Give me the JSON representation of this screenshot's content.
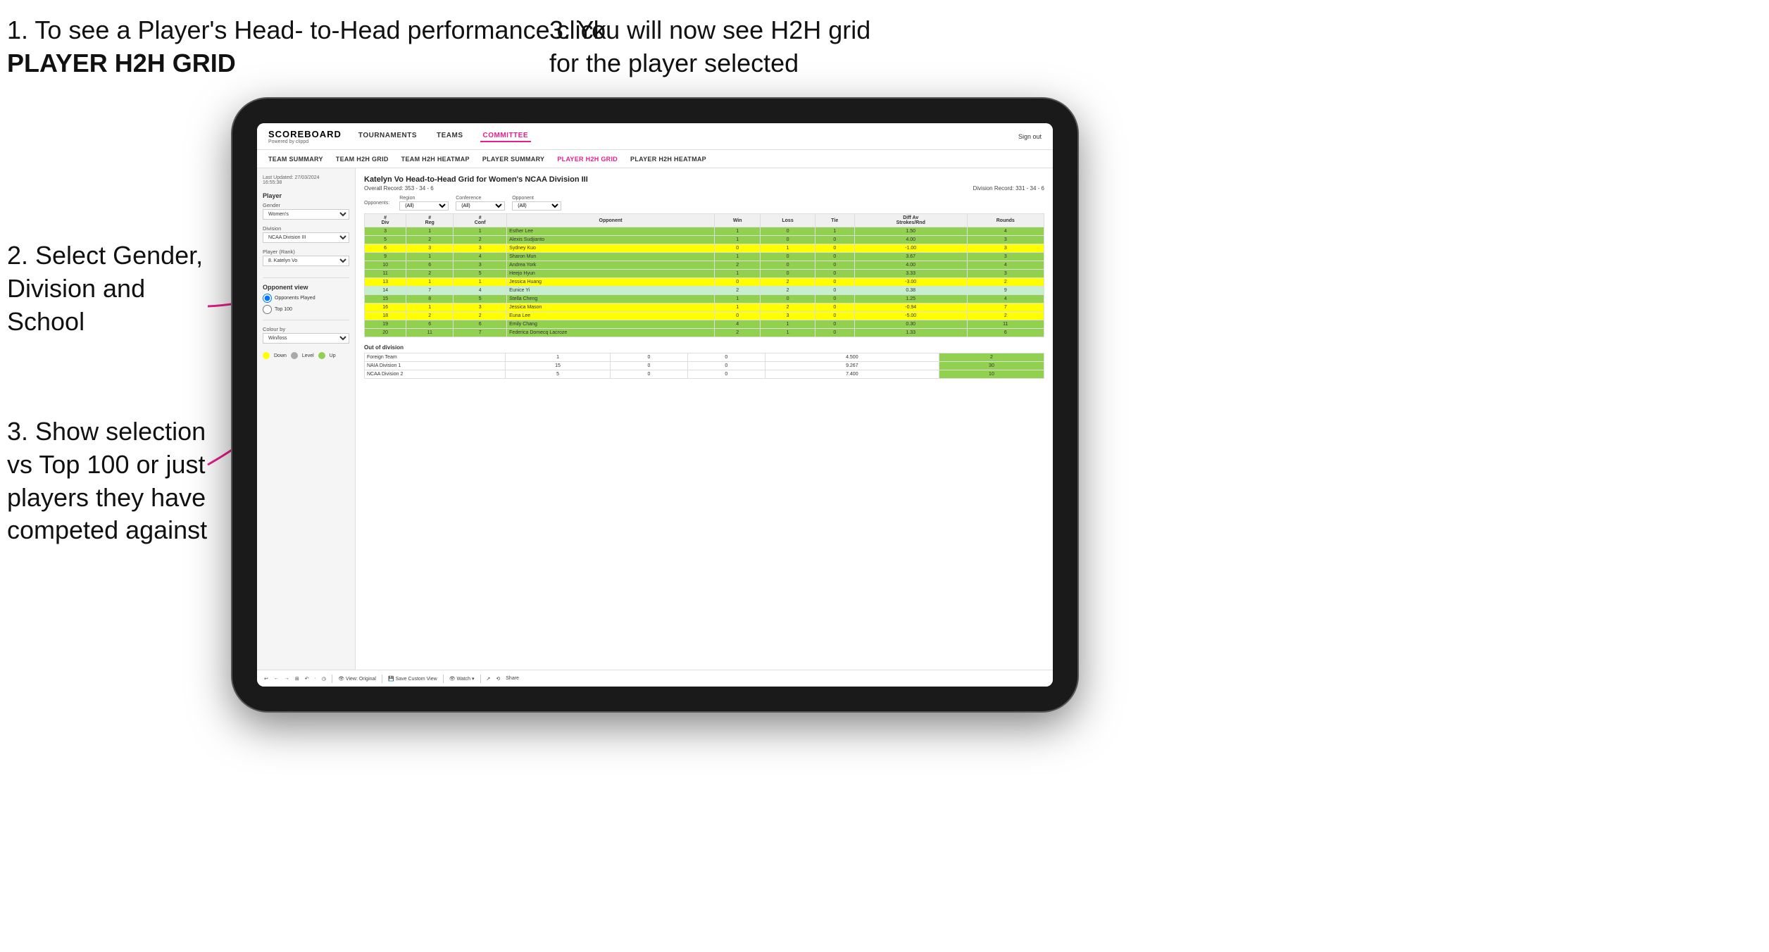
{
  "annotations": {
    "step1": "1. To see a Player's Head-\nto-Head performance click",
    "step1_bold": "PLAYER H2H GRID",
    "step2": "2. Select Gender,\nDivision and\nSchool",
    "step3_left": "3. Show selection\nvs Top 100 or just\nplayers they have\ncompeted against",
    "step3_right": "3. You will now see H2H grid\nfor the player selected"
  },
  "navbar": {
    "brand": "SCOREBOARD",
    "brand_sub": "Powered by clippd",
    "items": [
      "TOURNAMENTS",
      "TEAMS",
      "COMMITTEE"
    ],
    "active_item": "COMMITTEE",
    "sign_out": "Sign out"
  },
  "sub_navbar": {
    "items": [
      "TEAM SUMMARY",
      "TEAM H2H GRID",
      "TEAM H2H HEATMAP",
      "PLAYER SUMMARY",
      "PLAYER H2H GRID",
      "PLAYER H2H HEATMAP"
    ],
    "active": "PLAYER H2H GRID"
  },
  "sidebar": {
    "updated": "Last Updated: 27/03/2024\n16:55:38",
    "player_section": "Player",
    "gender_label": "Gender",
    "gender_value": "Women's",
    "division_label": "Division",
    "division_value": "NCAA Division III",
    "player_rank_label": "Player (Rank)",
    "player_rank_value": "8. Katelyn Vo",
    "opponent_view_label": "Opponent view",
    "radio_played": "Opponents Played",
    "radio_top100": "Top 100",
    "colour_by_label": "Colour by",
    "colour_by_value": "Win/loss",
    "legend": [
      {
        "color": "#ffff00",
        "label": "Down"
      },
      {
        "color": "#aaaaaa",
        "label": "Level"
      },
      {
        "color": "#92d050",
        "label": "Up"
      }
    ]
  },
  "grid": {
    "title": "Katelyn Vo Head-to-Head Grid for Women's NCAA Division III",
    "overall_record": "Overall Record: 353 - 34 - 6",
    "division_record": "Division Record: 331 - 34 - 6",
    "filters": {
      "opponents_label": "Opponents:",
      "region_label": "Region",
      "region_value": "(All)",
      "conference_label": "Conference",
      "conference_value": "(All)",
      "opponent_label": "Opponent",
      "opponent_value": "(All)"
    },
    "columns": [
      "#\nDiv",
      "#\nReg",
      "#\nConf",
      "Opponent",
      "Win",
      "Loss",
      "Tie",
      "Diff Av\nStrokes/Rnd",
      "Rounds"
    ],
    "rows": [
      {
        "div": 3,
        "reg": 1,
        "conf": 1,
        "opponent": "Esther Lee",
        "win": 1,
        "loss": 0,
        "tie": 1,
        "diff": 1.5,
        "rounds": 4,
        "color": "green"
      },
      {
        "div": 5,
        "reg": 2,
        "conf": 2,
        "opponent": "Alexis Sudjianto",
        "win": 1,
        "loss": 0,
        "tie": 0,
        "diff": 4.0,
        "rounds": 3,
        "color": "green"
      },
      {
        "div": 6,
        "reg": 3,
        "conf": 3,
        "opponent": "Sydney Kuo",
        "win": 0,
        "loss": 1,
        "tie": 0,
        "diff": -1.0,
        "rounds": 3,
        "color": "yellow"
      },
      {
        "div": 9,
        "reg": 1,
        "conf": 4,
        "opponent": "Sharon Mun",
        "win": 1,
        "loss": 0,
        "tie": 0,
        "diff": 3.67,
        "rounds": 3,
        "color": "green"
      },
      {
        "div": 10,
        "reg": 6,
        "conf": 3,
        "opponent": "Andrea York",
        "win": 2,
        "loss": 0,
        "tie": 0,
        "diff": 4.0,
        "rounds": 4,
        "color": "green"
      },
      {
        "div": 11,
        "reg": 2,
        "conf": 5,
        "opponent": "Heejo Hyun",
        "win": 1,
        "loss": 0,
        "tie": 0,
        "diff": 3.33,
        "rounds": 3,
        "color": "green"
      },
      {
        "div": 13,
        "reg": 1,
        "conf": 1,
        "opponent": "Jessica Huang",
        "win": 0,
        "loss": 2,
        "tie": 0,
        "diff": -3.0,
        "rounds": 2,
        "color": "yellow"
      },
      {
        "div": 14,
        "reg": 7,
        "conf": 4,
        "opponent": "Eunice Yi",
        "win": 2,
        "loss": 2,
        "tie": 0,
        "diff": 0.38,
        "rounds": 9,
        "color": "light-green"
      },
      {
        "div": 15,
        "reg": 8,
        "conf": 5,
        "opponent": "Stella Cheng",
        "win": 1,
        "loss": 0,
        "tie": 0,
        "diff": 1.25,
        "rounds": 4,
        "color": "green"
      },
      {
        "div": 16,
        "reg": 1,
        "conf": 3,
        "opponent": "Jessica Mason",
        "win": 1,
        "loss": 2,
        "tie": 0,
        "diff": -0.94,
        "rounds": 7,
        "color": "yellow"
      },
      {
        "div": 18,
        "reg": 2,
        "conf": 2,
        "opponent": "Euna Lee",
        "win": 0,
        "loss": 3,
        "tie": 0,
        "diff": -5.0,
        "rounds": 2,
        "color": "yellow"
      },
      {
        "div": 19,
        "reg": 6,
        "conf": 6,
        "opponent": "Emily Chang",
        "win": 4,
        "loss": 1,
        "tie": 0,
        "diff": 0.3,
        "rounds": 11,
        "color": "green"
      },
      {
        "div": 20,
        "reg": 11,
        "conf": 7,
        "opponent": "Federica Domecq Lacroze",
        "win": 2,
        "loss": 1,
        "tie": 0,
        "diff": 1.33,
        "rounds": 6,
        "color": "green"
      }
    ],
    "out_of_division": {
      "title": "Out of division",
      "rows": [
        {
          "label": "Foreign Team",
          "win": 1,
          "loss": 0,
          "tie": 0,
          "diff": 4.5,
          "rounds": 2
        },
        {
          "label": "NAIA Division 1",
          "win": 15,
          "loss": 0,
          "tie": 0,
          "diff": 9.267,
          "rounds": 30
        },
        {
          "label": "NCAA Division 2",
          "win": 5,
          "loss": 0,
          "tie": 0,
          "diff": 7.4,
          "rounds": 10
        }
      ]
    }
  },
  "toolbar": {
    "buttons": [
      "↩",
      "←",
      "→",
      "⊞",
      "↶",
      "·",
      "◷",
      "View: Original",
      "Save Custom View",
      "Watch ▾",
      "↗",
      "⟲",
      "Share"
    ]
  }
}
